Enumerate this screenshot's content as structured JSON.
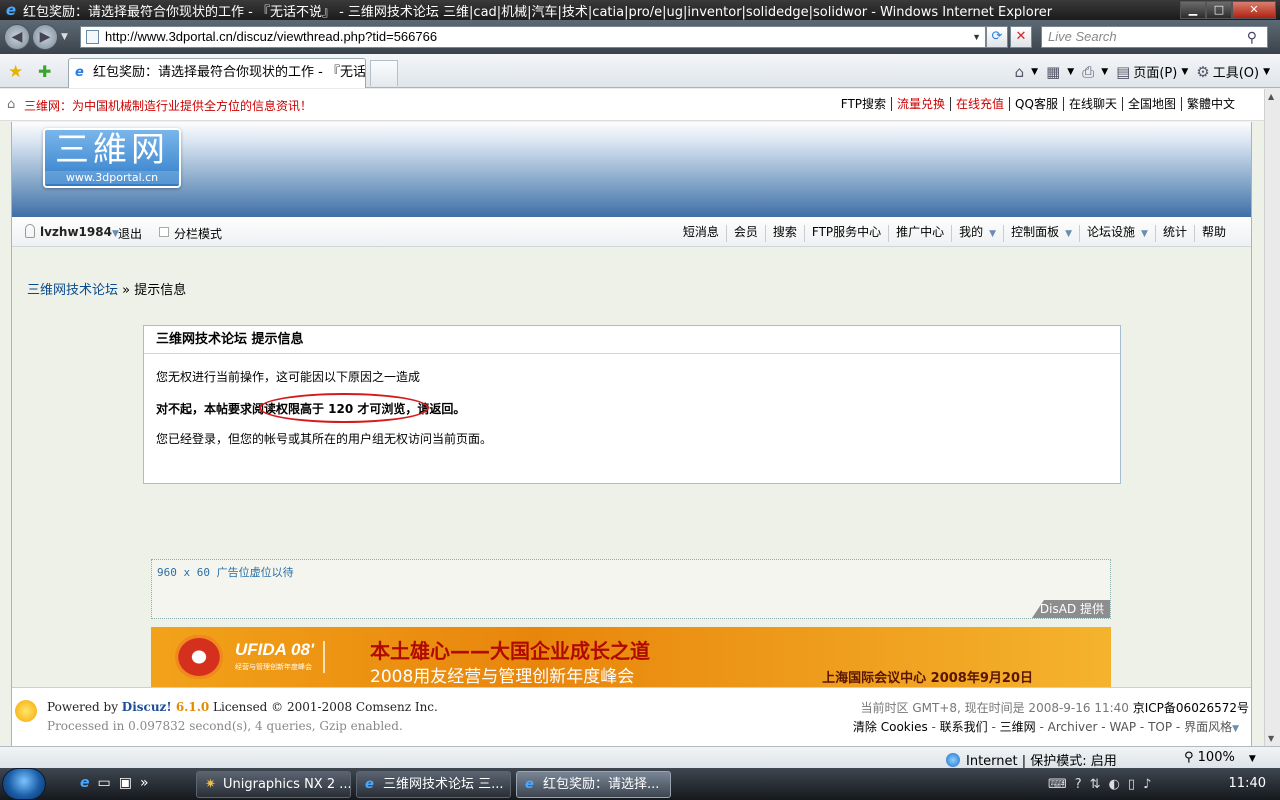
{
  "window": {
    "title": "红包奖励：请选择最符合你现状的工作 - 『无话不说』 - 三维网技术论坛 三维|cad|机械|汽车|技术|catia|pro/e|ug|inventor|solidedge|solidwor - Windows Internet Explorer"
  },
  "browser": {
    "url": "http://www.3dportal.cn/discuz/viewthread.php?tid=566766",
    "search_placeholder": "Live Search",
    "tab_title": "红包奖励：请选择最符合你现状的工作 - 『无话...",
    "commands": {
      "page": "页面(P)",
      "tools": "工具(O)"
    },
    "status_zone": "Internet | 保护模式: 启用",
    "zoom": "100%"
  },
  "site": {
    "slogan": "三维网：为中国机械制造行业提供全方位的信息资讯！",
    "toplinks": [
      "FTP搜索",
      "流量兑换",
      "在线充值",
      "QQ客服",
      "在线聊天",
      "全国地图",
      "繁體中文"
    ],
    "logo_cn": "三維网",
    "logo_url": "www.3dportal.cn",
    "username": "lvzhw1984",
    "logout": "退出",
    "split_mode": "分栏模式",
    "menu": [
      "短消息",
      "会员",
      "搜索",
      "FTP服务中心",
      "推广中心",
      "我的",
      "控制面板",
      "论坛设施",
      "统计",
      "帮助"
    ]
  },
  "breadcrumb": {
    "home": "三维网技术论坛",
    "sep": " » ",
    "current": "提示信息"
  },
  "message": {
    "header": "三维网技术论坛  提示信息",
    "line1": "您无权进行当前操作，这可能因以下原因之一造成",
    "line2": "对不起，本帖要求阅读权限高于 120 才可浏览，请返回。",
    "line3": "您已经登录，但您的帐号或其所在的用户组无权访问当前页面。"
  },
  "ads": {
    "placeholder": "960 x 60 广告位虚位以待",
    "provider": "DisAD 提供",
    "banner_brand": "UFIDA 08'",
    "banner_brand_sub": "经营与管理创新年度峰会",
    "banner_headline": "本土雄心——大国企业成长之道",
    "banner_subline": "2008用友经营与管理创新年度峰会",
    "banner_venue": "上海国际会议中心  2008年9月20日"
  },
  "footer": {
    "powered_prefix": "Powered by ",
    "brand": "Discuz!",
    "version": " 6.1.0",
    "license": " Licensed © 2001-2008 Comsenz Inc.",
    "processed": "Processed in 0.097832 second(s), 4 queries, Gzip enabled.",
    "timeinfo": "当前时区 GMT+8, 现在时间是 2008-9-16 11:40",
    "icp": "京ICP备06026572号",
    "links": [
      "清除 Cookies",
      "联系我们",
      "三维网",
      "Archiver",
      "WAP",
      "TOP",
      "界面风格"
    ]
  },
  "taskbar": {
    "tasks": [
      "Unigraphics NX 2 ...",
      "三维网技术论坛 三...",
      "红包奖励：请选择..."
    ],
    "clock": "11:40"
  },
  "icons": [
    "ie-icon",
    "back-icon",
    "forward-icon",
    "refresh-icon",
    "stop-icon",
    "search-icon",
    "favorites-star-icon",
    "add-favorite-icon",
    "home-icon",
    "feeds-icon",
    "print-icon",
    "page-icon",
    "tools-gear-icon",
    "globe-icon",
    "start-orb-icon",
    "bulb-icon"
  ]
}
